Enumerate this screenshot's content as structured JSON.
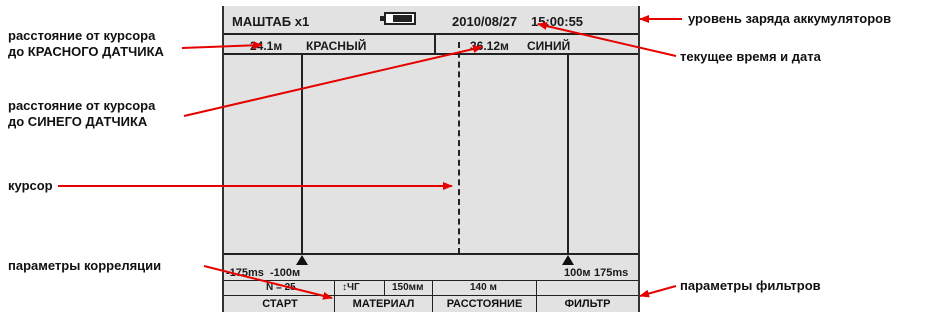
{
  "device": {
    "scale_label": "МАШТАБ х1",
    "date": "2010/08/27",
    "time": "15:00:55",
    "red_distance": "24.1м",
    "red_label": "КРАСНЫЙ",
    "blue_distance": "36.12м",
    "blue_label": "СИНИЙ",
    "scale_left_outer": "-175ms",
    "scale_left_inner": "-100м",
    "scale_right_inner": "100м",
    "scale_right_outer": "175ms",
    "params": {
      "n": "N = 25",
      "mode": "↕ЧГ",
      "diameter": "150мм",
      "length": "140 м"
    },
    "buttons": [
      "СТАРТ",
      "МАТЕРИАЛ",
      "РАССТОЯНИЕ",
      "ФИЛЬТР"
    ]
  },
  "annotations": {
    "red_sensor_line1": "расстояние от курсора",
    "red_sensor_line2": "до КРАСНОГО ДАТЧИКА",
    "blue_sensor_line1": "расстояние от курсора",
    "blue_sensor_line2": "до СИНЕГО ДАТЧИКА",
    "cursor": "курсор",
    "correlation": "параметры корреляции",
    "battery": "уровень заряда аккумуляторов",
    "datetime": "текущее время и дата",
    "filters": "параметры фильтров"
  }
}
